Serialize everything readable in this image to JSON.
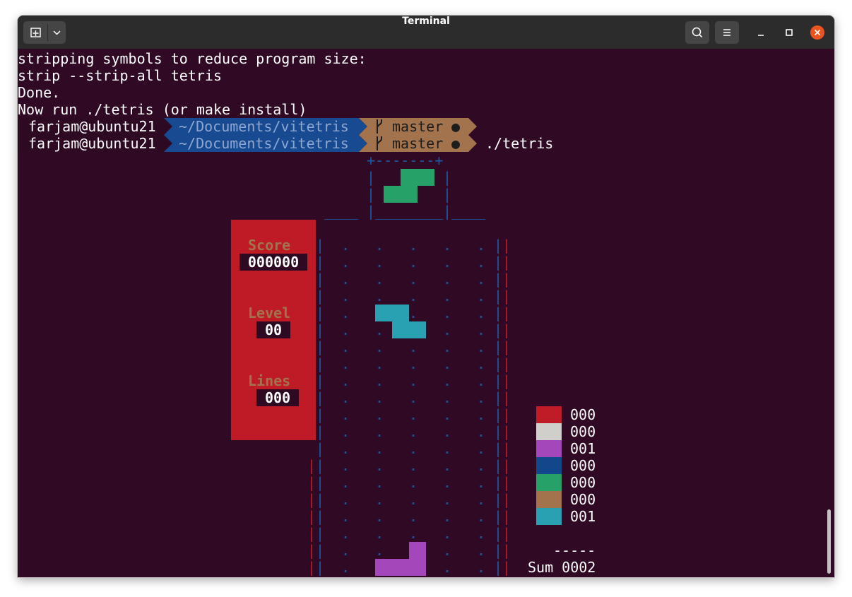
{
  "window": {
    "title": "Terminal",
    "new_tab_icon": "new-tab-icon",
    "tab_menu_icon": "chevron-down-icon",
    "search_icon": "search-icon",
    "menu_icon": "hamburger-menu-icon",
    "minimize_icon": "minimize-icon",
    "maximize_icon": "maximize-icon",
    "close_icon": "close-icon",
    "close_color": "#e95420"
  },
  "terminal": {
    "lines": [
      "stripping symbols to reduce program size:",
      "strip --strip-all tetris",
      "Done.",
      "Now run ./tetris (or make install)"
    ],
    "prompts": [
      {
        "user": "farjam@ubuntu21",
        "path": "~/Documents/vitetris",
        "branch_icon": "git-branch-icon",
        "branch": "master",
        "dirty": "●",
        "command": ""
      },
      {
        "user": "farjam@ubuntu21",
        "path": "~/Documents/vitetris",
        "branch_icon": "git-branch-icon",
        "branch": "master",
        "dirty": "●",
        "command": "./tetris"
      }
    ],
    "colors": {
      "background": "#300a24",
      "user_bg": "#2d0922",
      "path_bg": "#184a92",
      "git_bg": "#a2734c",
      "text": "#ffffff"
    }
  },
  "game": {
    "next_box_top": "+-------+",
    "next_box_side": "|",
    "next_box_bottom_left": "____",
    "next_box_bottom_mid": "________",
    "next_box_bottom_right": "____",
    "well_wall": "|",
    "well_dot": ".",
    "floor_left": "+*****",
    "floor_mid": "======",
    "floor_right": "********+",
    "score_label": "Score",
    "score_value": "000000",
    "level_label": "Level",
    "level_value": "00",
    "lines_label": "Lines",
    "lines_value": "000",
    "colors": {
      "panel_bg": "#bf1b27",
      "panel_label": "#a2734c",
      "value_bg": "#2d0922",
      "well_blue": "#1c5aa8",
      "well_red": "#bf1b27",
      "next_piece": "#26a269",
      "falling_piece": "#2aa1b3",
      "landed_piece": "#a347ba"
    }
  },
  "statistics": {
    "rows": [
      {
        "color": "#c01c28",
        "count": "000"
      },
      {
        "color": "#d0cfcc",
        "count": "000"
      },
      {
        "color": "#a347ba",
        "count": "001"
      },
      {
        "color": "#12488b",
        "count": "000"
      },
      {
        "color": "#26a269",
        "count": "000"
      },
      {
        "color": "#a2734c",
        "count": "000"
      },
      {
        "color": "#2aa1b3",
        "count": "001"
      }
    ],
    "separator": "-----",
    "sum_label": "Sum 0002"
  }
}
